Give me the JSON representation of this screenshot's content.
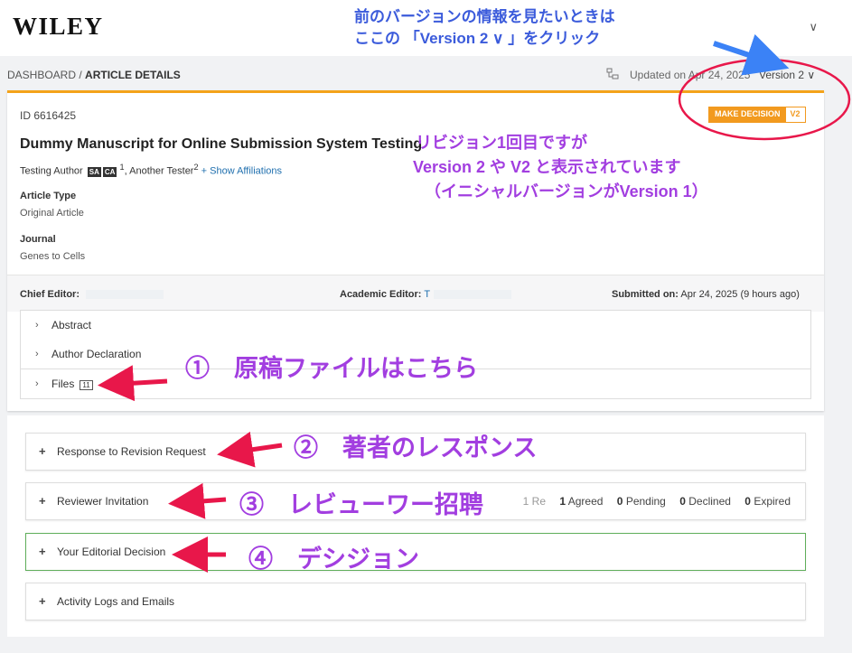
{
  "header": {
    "logo": "WILEY",
    "user_menu": "∨"
  },
  "breadcrumb": {
    "root": "DASHBOARD",
    "sep": " / ",
    "current": "ARTICLE DETAILS"
  },
  "meta": {
    "updated": "Updated on Apr 24, 2025",
    "version": "Version 2 ∨"
  },
  "article": {
    "id": "ID 6616425",
    "decision_label": "MAKE DECISION",
    "decision_version": "V2",
    "title": "Dummy Manuscript for Online Submission System Testing",
    "author1": "Testing Author",
    "badge_sa": "SA",
    "badge_ca": "CA",
    "sup1": "1",
    "author2": ", Another Tester",
    "sup2": "2",
    "affiliations": "+ Show Affiliations",
    "type_label": "Article Type",
    "type_value": "Original Article",
    "journal_label": "Journal",
    "journal_value": "Genes to Cells",
    "chief_editor_label": "Chief Editor:",
    "chief_editor_value": "",
    "academic_editor_label": "Academic Editor:",
    "academic_editor_value": "T",
    "submitted_label": "Submitted on:",
    "submitted_value": "Apr 24, 2025 (9 hours ago)"
  },
  "accordions": [
    {
      "label": "Abstract"
    },
    {
      "label": "Author Declaration"
    },
    {
      "label": "Files",
      "count": "11"
    }
  ],
  "sections": [
    {
      "label": "Response to Revision Request"
    },
    {
      "label": "Reviewer Invitation"
    },
    {
      "label": "Your Editorial Decision"
    },
    {
      "label": "Activity Logs and Emails"
    }
  ],
  "reviewer_stats": {
    "partial": "1 Re",
    "agreed_n": "1",
    "agreed": "Agreed",
    "pending_n": "0",
    "pending": "Pending",
    "declined_n": "0",
    "declined": "Declined",
    "expired_n": "0",
    "expired": "Expired"
  },
  "annotations": {
    "version_note_1": "前のバージョンの情報を見たいときは",
    "version_note_2": "ここの 「Version 2 ∨ 」をクリック",
    "revision_note_1": "リビジョン1回目ですが",
    "revision_note_2": "Version 2 や V2 と表示されています",
    "revision_note_3": "（イニシャルバージョンがVersion 1）",
    "step1": "①　原稿ファイルはこちら",
    "step2": "②　著者のレスポンス",
    "step3": "③　レビューワー招聘",
    "step4": "④　デシジョン"
  },
  "colors": {
    "accent_orange": "#f29a1f",
    "link_blue": "#1f6fae",
    "annotation_purple": "#a23ee0",
    "annotation_blue": "#3b5bdb",
    "arrow_red": "#e8174a",
    "decision_green": "#5fae5a"
  }
}
